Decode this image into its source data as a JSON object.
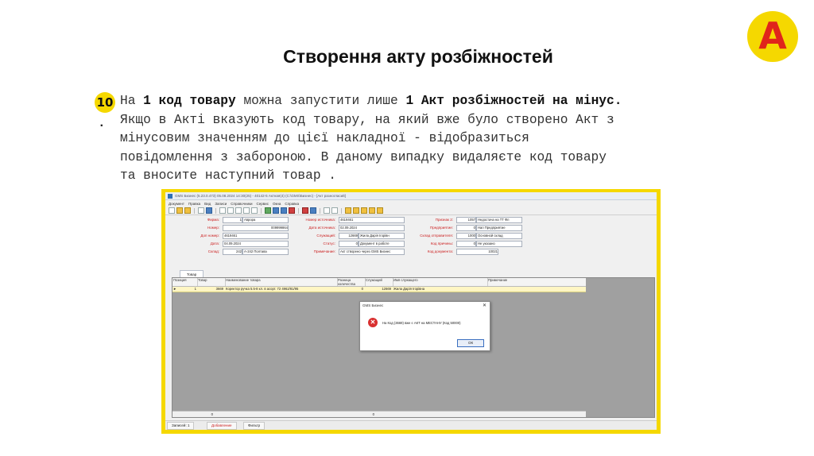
{
  "logo": {
    "letter": "A"
  },
  "slide_title": "Створення акту розбіжностей",
  "item_number": "10",
  "item_dot": ".",
  "paragraph": {
    "l1_a": "На ",
    "l1_b": "1 код товару",
    "l1_c": " можна запустити лише ",
    "l1_d": "1 Акт розбіжностей на мінус.",
    "l2": "Якщо в Акті вказують код товару, на який вже було створено Акт з",
    "l3": "мінусовим значенням до цієї накладної - відобразиться",
    "l4": "повідомлення з забороною. В даному випадку видаляєте код товару",
    "l5": "та вносите наступний товар ."
  },
  "colors": {
    "accent_yellow": "#f5d800",
    "logo_red": "#e0241b",
    "label_red": "#cc2020"
  },
  "app": {
    "title": "GMS Бизнес (5.23.0.473) 05.08.2024 14:30(25) - 40142-5 Актная(4) (С:\\GMS\\Бизнес) - [Акт разногласий]",
    "menu": [
      "Документ",
      "Правка",
      "Вид",
      "Записи",
      "Справочники",
      "Сервис",
      "Окна",
      "Справка"
    ],
    "form": {
      "firm_label": "Фирма:",
      "firm_code": "1",
      "firm_value": "Аврора",
      "number_label": "Номер:",
      "number_value": "009999864",
      "dopnum_label": "Доп номер:",
      "dopnum_value": "4619461",
      "date_label": "Дата:",
      "date_value": "04.09.2024",
      "warehouse_label": "Склад:",
      "warehouse_code": "242",
      "warehouse_value": "А-242 Полтава",
      "srcnum_label": "Номер источника:",
      "srcnum_value": "4619461",
      "srcdate_label": "Дата источника:",
      "srcdate_value": "02.09.2024",
      "employee_label": "Служащий:",
      "employee_code": "12669",
      "employee_value": "Жила Дарія Ігорівн",
      "status_label": "Статус:",
      "status_code": "0",
      "status_value": "Документ в работе",
      "note_label": "Примечание:",
      "note_value": "Акт створено через GMS Бизнес",
      "attr2_label": "Признак 2:",
      "attr2_code": "1057",
      "attr2_value": "Недостача на ТТ Фл",
      "company_label": "Предприятие:",
      "company_code": "0",
      "company_value": "Нап Предприятие",
      "senderwh_label": "Склад отправителя:",
      "senderwh_code": "1000",
      "senderwh_value": "Основной склад",
      "reason_label": "Код причины:",
      "reason_code": "0",
      "reason_value": "Не указано",
      "doccode_label": "Код документа:",
      "doccode_value": "10021"
    },
    "tab_goods": "Товар",
    "grid": {
      "columns": [
        "Позиция",
        "Товар",
        "Наименование товара",
        "Разница количества",
        "Служащий",
        "Имя служащего",
        "Примечание"
      ],
      "rows": [
        {
          "marker": "►",
          "pos": "1",
          "code": "3669",
          "name": "Коректор ручка 5.5-8 кл. в асорт. 72 4962/81/95",
          "diff": "0",
          "emp": "12669",
          "empname": "Жила Дарія Ігорівна",
          "note": ""
        }
      ],
      "footer_sum": "0"
    },
    "dialog": {
      "title": "GMS Бизнес",
      "close": "✕",
      "message": "На Код (3669) вже є АКТ на МЕСТАНУ (Код 50000)",
      "ok": "ОК"
    },
    "statusbar": {
      "records": "Записей: 1",
      "add": "Добавление",
      "filter": "Фильтр"
    }
  }
}
